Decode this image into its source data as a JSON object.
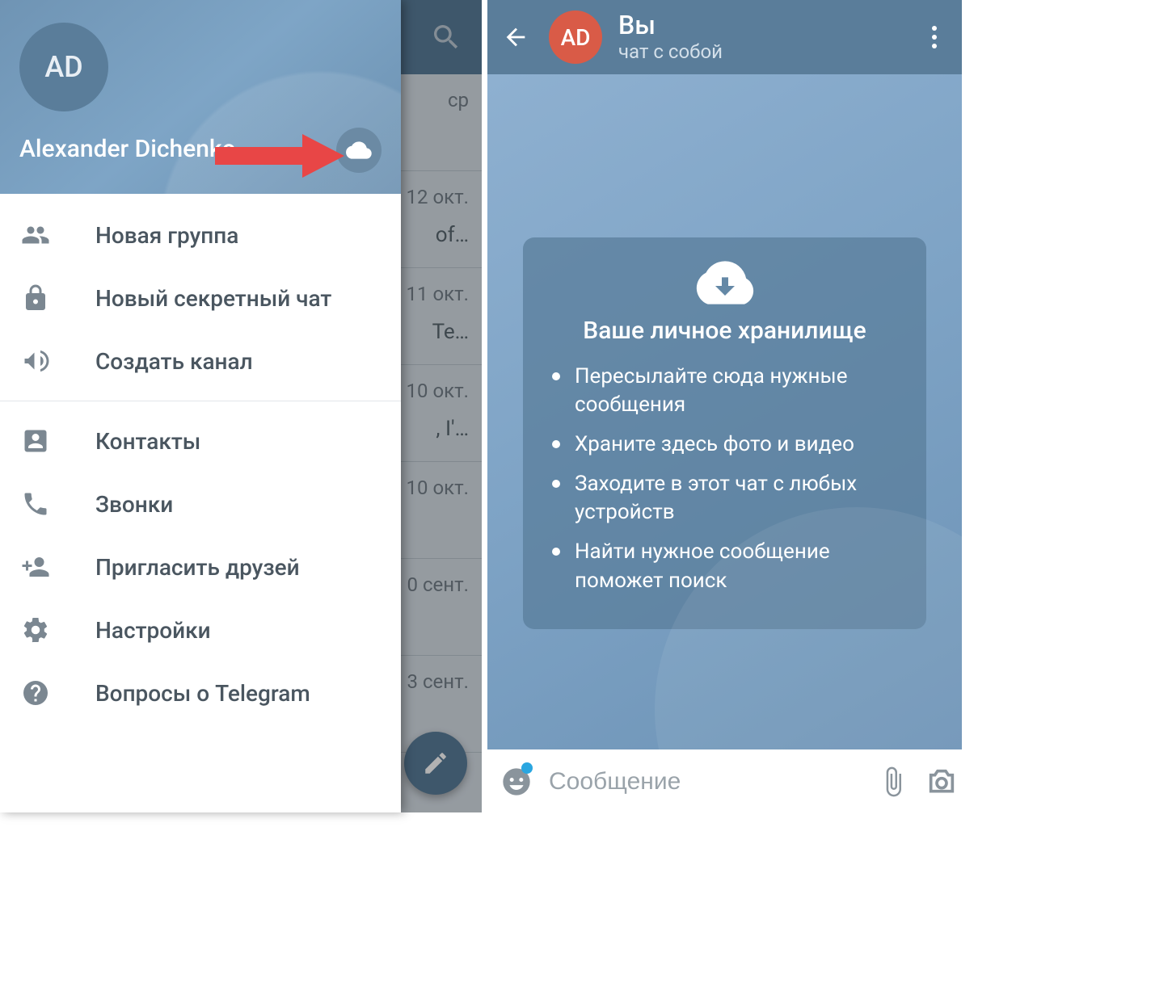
{
  "left": {
    "user_initials": "AD",
    "user_name": "Alexander Dichenko",
    "menu": [
      {
        "label": "Новая группа"
      },
      {
        "label": "Новый секретный чат"
      },
      {
        "label": "Создать канал"
      },
      {
        "label": "Контакты"
      },
      {
        "label": "Звонки"
      },
      {
        "label": "Пригласить друзей"
      },
      {
        "label": "Настройки"
      },
      {
        "label": "Вопросы о Telegram"
      }
    ],
    "bg_rows": [
      {
        "date": "ср",
        "snippet": ""
      },
      {
        "date": "12 окт.",
        "snippet": "of…"
      },
      {
        "date": "11 окт.",
        "snippet": "Те…"
      },
      {
        "date": "10 окт.",
        "snippet": ", I'…"
      },
      {
        "date": "10 окт.",
        "snippet": ""
      },
      {
        "date": "0 сент.",
        "snippet": ""
      },
      {
        "date": "3 сент.",
        "snippet": ""
      }
    ]
  },
  "right": {
    "avatar_initials": "AD",
    "title": "Вы",
    "subtitle": "чат с собой",
    "card_title": "Ваше личное хранилище",
    "bullets": [
      "Пересылайте сюда нужные сообщения",
      "Храните здесь фото и видео",
      "Заходите в этот чат с любых устройств",
      "Найти нужное сообщение поможет поиск"
    ],
    "input_placeholder": "Сообщение"
  }
}
